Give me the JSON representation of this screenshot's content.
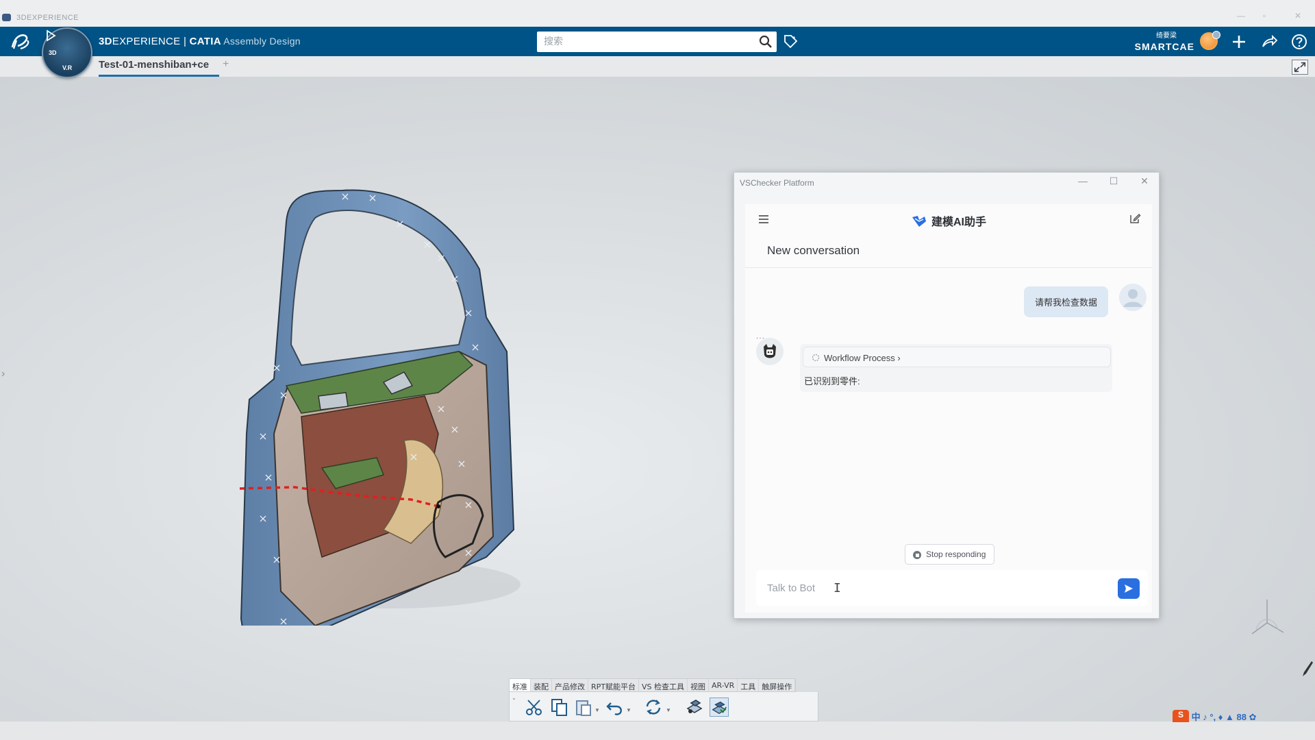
{
  "os": {
    "title": "3DEXPERIENCE"
  },
  "topbar": {
    "brand_bold": "3D",
    "brand_rest": "EXPERIENCE | ",
    "app_bold": "CATIA",
    "app_module": " Assembly Design",
    "search_placeholder": "搜索",
    "user_name": "绮要梁",
    "company": "SMARTCAE ⌄",
    "avatar_text": "3"
  },
  "compass": {
    "label_3d": "3D",
    "label_vr": "V.R"
  },
  "tabs": {
    "active_label": "Test-01-menshiban+ce",
    "add_label": "+"
  },
  "chat": {
    "window_title": "VSChecker Platform",
    "bot_name": "建模AI助手",
    "conversation_title": "New conversation",
    "user_message": "请帮我检查数据",
    "workflow_label": "Workflow Process ›",
    "bot_text": "已识别到零件:",
    "stop_label": "Stop responding",
    "input_placeholder": "Talk to Bot",
    "bot_dots": "···"
  },
  "action_bar": {
    "tabs": [
      "标准",
      "装配",
      "产品修改",
      "RPT赋能平台",
      "VS 检查工具",
      "视图",
      "AR-VR",
      "工具",
      "触屏操作"
    ],
    "active_tab_index": 0
  },
  "ime": {
    "logo": "S",
    "text": "中 ♪ °, ♦ ▲ 88 ✿"
  },
  "colors": {
    "topbar": "#005386",
    "accent": "#2a6fe0",
    "door_frame": "#6e8fb4",
    "door_trim": "#5a7d44",
    "door_panel": "#b8a79c",
    "door_cavity": "#8a4b3c",
    "marker_line": "#e02020"
  }
}
